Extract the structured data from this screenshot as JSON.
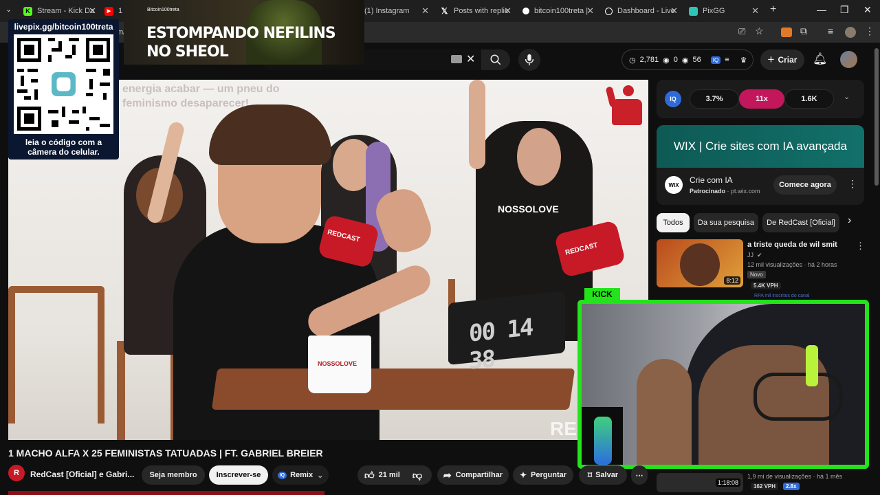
{
  "browser": {
    "tabs": [
      {
        "title": "Stream - Kick Da",
        "fav": "K",
        "color": "#53fc18"
      },
      {
        "title": "1",
        "fav": "▶",
        "color": "#ff0000"
      },
      {
        "title": "Bitcoin100treta",
        "fav": "",
        "color": "#e8a33d"
      },
      {
        "title": "(1) Instagram",
        "fav": "",
        "color": "#c13584"
      },
      {
        "title": "Posts with replie",
        "fav": "𝕏",
        "color": "#ffffff"
      },
      {
        "title": "bitcoin100treta |",
        "fav": "",
        "color": "#ffffff"
      },
      {
        "title": "Dashboard - Live",
        "fav": "",
        "color": "#ffffff"
      },
      {
        "title": "PixGG",
        "fav": "",
        "color": "#2ec4b6"
      }
    ],
    "address_fragment": "m/"
  },
  "stream_overlay": {
    "qr_url": "livepix.gg/bitcoin100treta",
    "qr_caption_1": "leia o código com a",
    "qr_caption_2": "câmera do celular.",
    "banner_channel": "Bitcoin100treta",
    "banner_line_1": "ESTOMPANDO NEFILINS",
    "banner_line_2": "NO SHEOL",
    "kick_label": "KICK"
  },
  "header": {
    "stat_views": "2,781",
    "stat_zero": "0",
    "stat_watchers": "56",
    "create_label": "Criar"
  },
  "video": {
    "caption_line_1": "energia acabar — um pneu do",
    "caption_line_2": "feminismo desaparecer!",
    "timer": "00 14 38",
    "mug_brand": "NOSSOLOVE",
    "mic_brand": "REDCAST",
    "shirt_brand": "NOSSOLOVE",
    "watermark": "RED"
  },
  "below": {
    "title": "1 MACHO ALFA X 25 FEMINISTAS TATUADAS | FT. GABRIEL BREIER",
    "channel": "RedCast [Oficial] e Gabri...",
    "join": "Seja membro",
    "subscribe": "Inscrever-se",
    "remix": "Remix",
    "likes": "21 mil",
    "share": "Compartilhar",
    "ask": "Perguntar",
    "save": "Salvar"
  },
  "sidebar": {
    "metrics": [
      "3.7%",
      "11x",
      "1.6K"
    ],
    "ad_banner": "WIX | Crie sites com IA avançada",
    "ad_title": "Crie com IA",
    "ad_sponsor": "Patrocinado",
    "ad_domain": "pt.wix.com",
    "ad_cta": "Comece agora",
    "chips": [
      "Todos",
      "Da sua pesquisa",
      "De RedCast [Oficial]"
    ],
    "rec1": {
      "title": "a triste queda de wil smit",
      "channel": "JJ",
      "meta": "12 mil visualizações · há 2 horas",
      "badge": "Novo",
      "vph": "5.4K VPH",
      "duration": "8:12",
      "extra": "RPA mil  inscritos do canal"
    },
    "rec2": {
      "duration": "1:18:08",
      "meta": "1,9 mi de visualizações · há 1 mês",
      "vph": "162 VPH",
      "ratio": "2.8x"
    }
  }
}
